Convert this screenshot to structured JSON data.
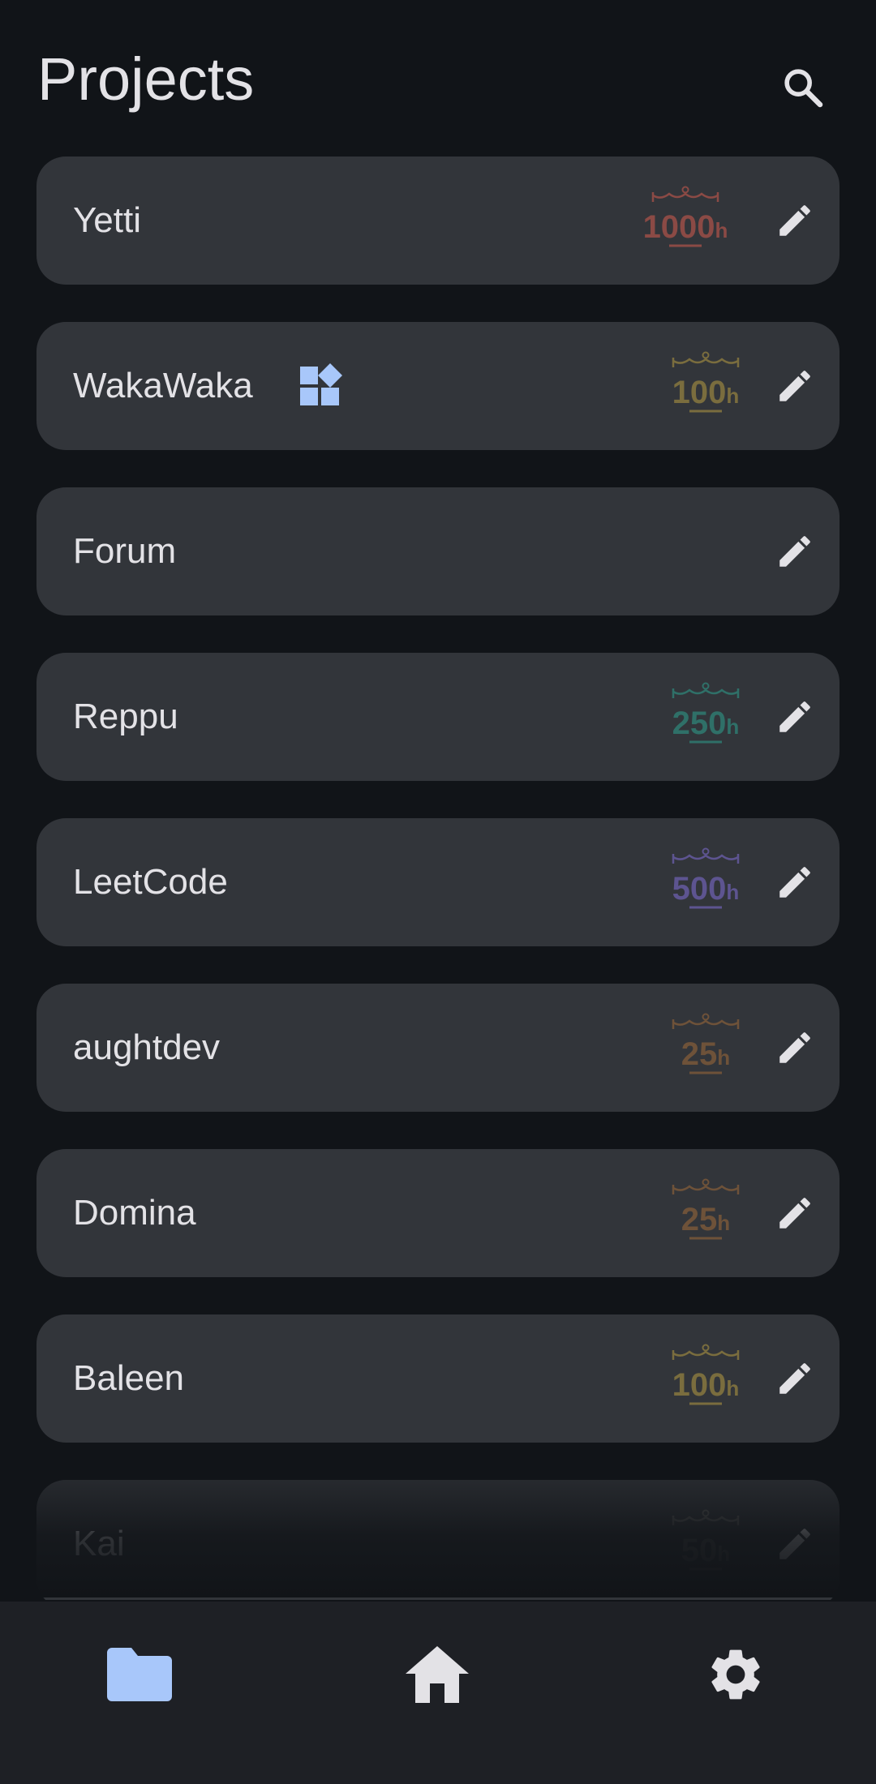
{
  "header": {
    "title": "Projects"
  },
  "colors": {
    "background": "#111418",
    "card": "#32353a",
    "text": "#e3e2e6",
    "accent": "#a8c7fa",
    "navbar": "#1e2025"
  },
  "projects": [
    {
      "name": "Yetti",
      "badge": {
        "label": "1000",
        "unit": "h",
        "color": "#8b4a45"
      }
    },
    {
      "name": "WakaWaka",
      "badge": {
        "label": "100",
        "unit": "h",
        "color": "#7a6d3e"
      },
      "extra_icon": "widgets-icon"
    },
    {
      "name": "Forum"
    },
    {
      "name": "Reppu",
      "badge": {
        "label": "250",
        "unit": "h",
        "color": "#2f7068"
      }
    },
    {
      "name": "LeetCode",
      "badge": {
        "label": "500",
        "unit": "h",
        "color": "#5d5490"
      }
    },
    {
      "name": "aughtdev",
      "badge": {
        "label": "25",
        "unit": "h",
        "color": "#6e5239"
      }
    },
    {
      "name": "Domina",
      "badge": {
        "label": "25",
        "unit": "h",
        "color": "#6e5239"
      }
    },
    {
      "name": "Baleen",
      "badge": {
        "label": "100",
        "unit": "h",
        "color": "#7a6d3e"
      }
    },
    {
      "name": "Kai",
      "badge": {
        "label": "50",
        "unit": "h",
        "color": "#555555"
      }
    }
  ],
  "navbar": {
    "items": [
      {
        "icon": "folder-icon",
        "active": true
      },
      {
        "icon": "home-icon",
        "active": false
      },
      {
        "icon": "gear-icon",
        "active": false
      }
    ]
  }
}
